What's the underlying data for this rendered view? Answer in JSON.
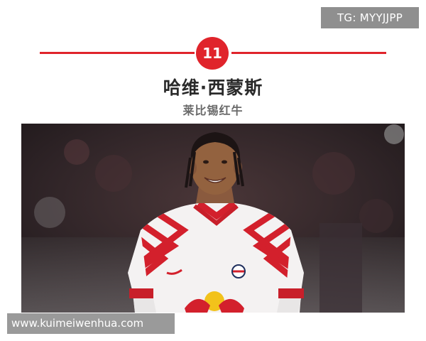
{
  "watermark_top": "TG: MYYJJPP",
  "rank": "11",
  "player": {
    "name": "哈维·西蒙斯",
    "club": "莱比锡红牛"
  },
  "photo": {
    "subject": "player-photo",
    "kit_colors": {
      "jersey": "#f4f2f2",
      "stripes": "#d3202c",
      "sleeve_band": "#c81f2a",
      "background": "#2b2023"
    }
  },
  "watermark_bottom": "www.kuimeiwenhua.com",
  "colors": {
    "accent": "#e0242b",
    "title": "#2a2a2a",
    "subtitle": "#6a6a6a"
  }
}
